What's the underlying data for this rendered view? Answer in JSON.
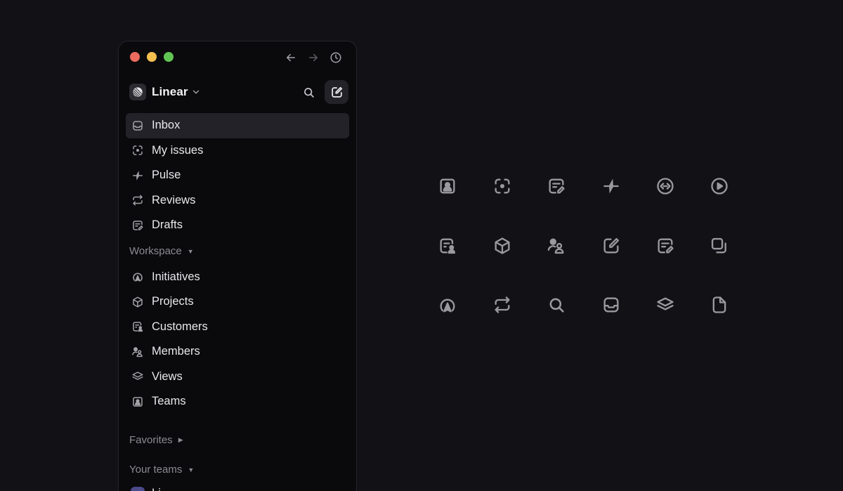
{
  "colors": {
    "background": "#121116",
    "sidebar": "#0a090b",
    "active_item": "#232228",
    "icon_stroke": "#9a99a0",
    "sidebar_icon_stroke": "#a3a2a8",
    "traffic_red": "#ec6a5e",
    "traffic_yellow": "#f4bf4f",
    "traffic_green": "#61c554"
  },
  "titlebar": {
    "icons": [
      "arrow-left-icon",
      "arrow-right-icon",
      "clock-icon"
    ]
  },
  "workspace": {
    "name": "Linear",
    "icons": [
      "linear-logo-icon",
      "chevron-down-icon",
      "search-icon",
      "compose-icon"
    ]
  },
  "nav": {
    "items": [
      {
        "label": "Inbox",
        "icon": "inbox-icon",
        "active": true
      },
      {
        "label": "My issues",
        "icon": "focus-icon",
        "active": false
      },
      {
        "label": "Pulse",
        "icon": "pulse-icon",
        "active": false
      },
      {
        "label": "Reviews",
        "icon": "repeat-icon",
        "active": false
      },
      {
        "label": "Drafts",
        "icon": "drafts-icon",
        "active": false
      }
    ]
  },
  "workspace_section": {
    "label": "Workspace",
    "items": [
      {
        "label": "Initiatives",
        "icon": "initiatives-icon"
      },
      {
        "label": "Projects",
        "icon": "cube-icon"
      },
      {
        "label": "Customers",
        "icon": "customers-icon"
      },
      {
        "label": "Members",
        "icon": "members-icon"
      },
      {
        "label": "Views",
        "icon": "layers-icon"
      },
      {
        "label": "Teams",
        "icon": "teams-icon"
      }
    ]
  },
  "favorites": {
    "label": "Favorites"
  },
  "your_teams": {
    "label": "Your teams",
    "first_team": "Li"
  },
  "icon_grid": {
    "rows": [
      [
        "teams-icon",
        "focus-icon",
        "drafts-icon",
        "pulse-icon",
        "code-icon",
        "play-icon"
      ],
      [
        "customers-icon",
        "cube-icon",
        "members-icon",
        "compose-icon",
        "drafts-icon",
        "duplicate-icon"
      ],
      [
        "initiatives-icon",
        "repeat-icon",
        "search-icon",
        "inbox-icon",
        "layers-icon",
        "document-icon"
      ]
    ]
  }
}
